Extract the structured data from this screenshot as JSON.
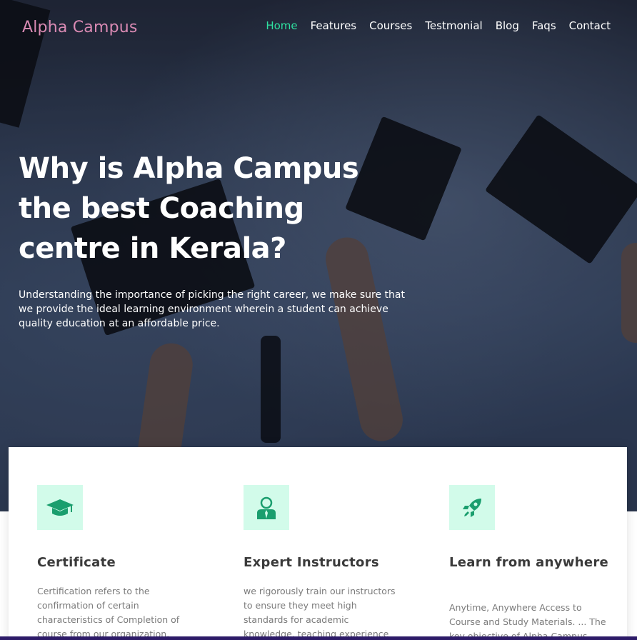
{
  "nav": {
    "logo": "Alpha Campus",
    "items": [
      {
        "label": "Home",
        "active": true
      },
      {
        "label": "Features",
        "active": false
      },
      {
        "label": "Courses",
        "active": false
      },
      {
        "label": "Testmonial",
        "active": false
      },
      {
        "label": "Blog",
        "active": false
      },
      {
        "label": "Faqs",
        "active": false
      },
      {
        "label": "Contact",
        "active": false
      }
    ]
  },
  "hero": {
    "title_lines": [
      "Why is Alpha Campus",
      "the best Coaching",
      "centre in Kerala?"
    ],
    "description": "Understanding the importance of picking the right career, we make sure that we provide the ideal learning environment wherein a student can achieve quality education at an affordable price."
  },
  "features": [
    {
      "icon": "graduation-cap-icon",
      "title": "Certificate",
      "text": "Certification refers to the confirmation of certain characteristics of Completion of course from our organization."
    },
    {
      "icon": "instructor-icon",
      "title": "Expert Instructors",
      "text": "we rigorously train our instructors to ensure they meet high standards for academic knowledge, teaching experience"
    },
    {
      "icon": "rocket-icon",
      "title": "Learn from anywhere",
      "text": "Anytime, Anywhere Access to Course and Study Materials. ... The key objective of Alpha Campus"
    }
  ],
  "colors": {
    "accent": "#2fe0a0",
    "logo": "#d98ab3",
    "icon_bg": "#d2fbea",
    "bottom_bar": "#2d1b68"
  }
}
